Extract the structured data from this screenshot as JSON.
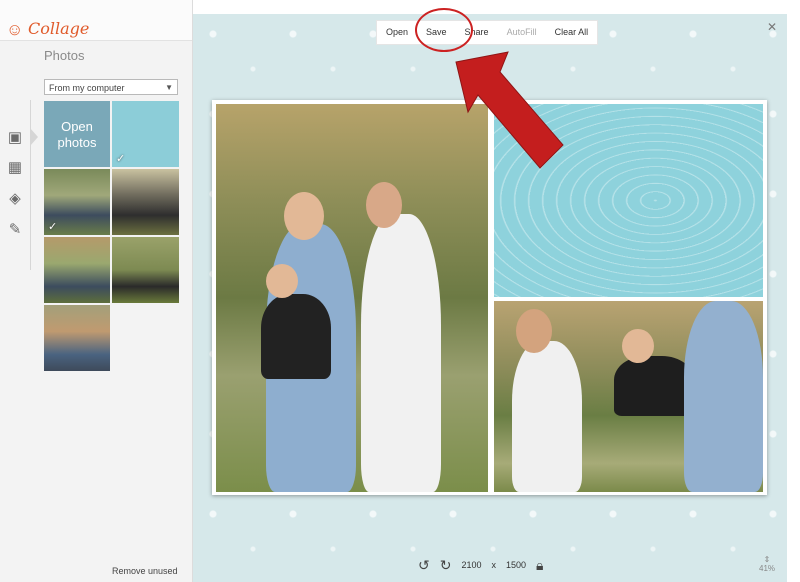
{
  "app": {
    "name": "Collage"
  },
  "sidebar": {
    "title": "Photos",
    "source_select": "From my computer",
    "open_photos_label": "Open photos",
    "remove_unused": "Remove unused",
    "tool_icons": [
      "image-icon",
      "layout-icon",
      "pattern-icon",
      "palette-icon"
    ]
  },
  "toolbar": {
    "open": "Open",
    "save": "Save",
    "share": "Share",
    "autofill": "AutoFill",
    "clear_all": "Clear All"
  },
  "canvas": {
    "width_value": "2100",
    "times": "x",
    "height_value": "1500"
  },
  "zoom": {
    "label": "41%"
  },
  "colors": {
    "accent_logo": "#e05a2a",
    "highlight_red": "#cc2222",
    "wood_teal": "#8ed2dc",
    "background_pattern": "#d6e8ea"
  }
}
